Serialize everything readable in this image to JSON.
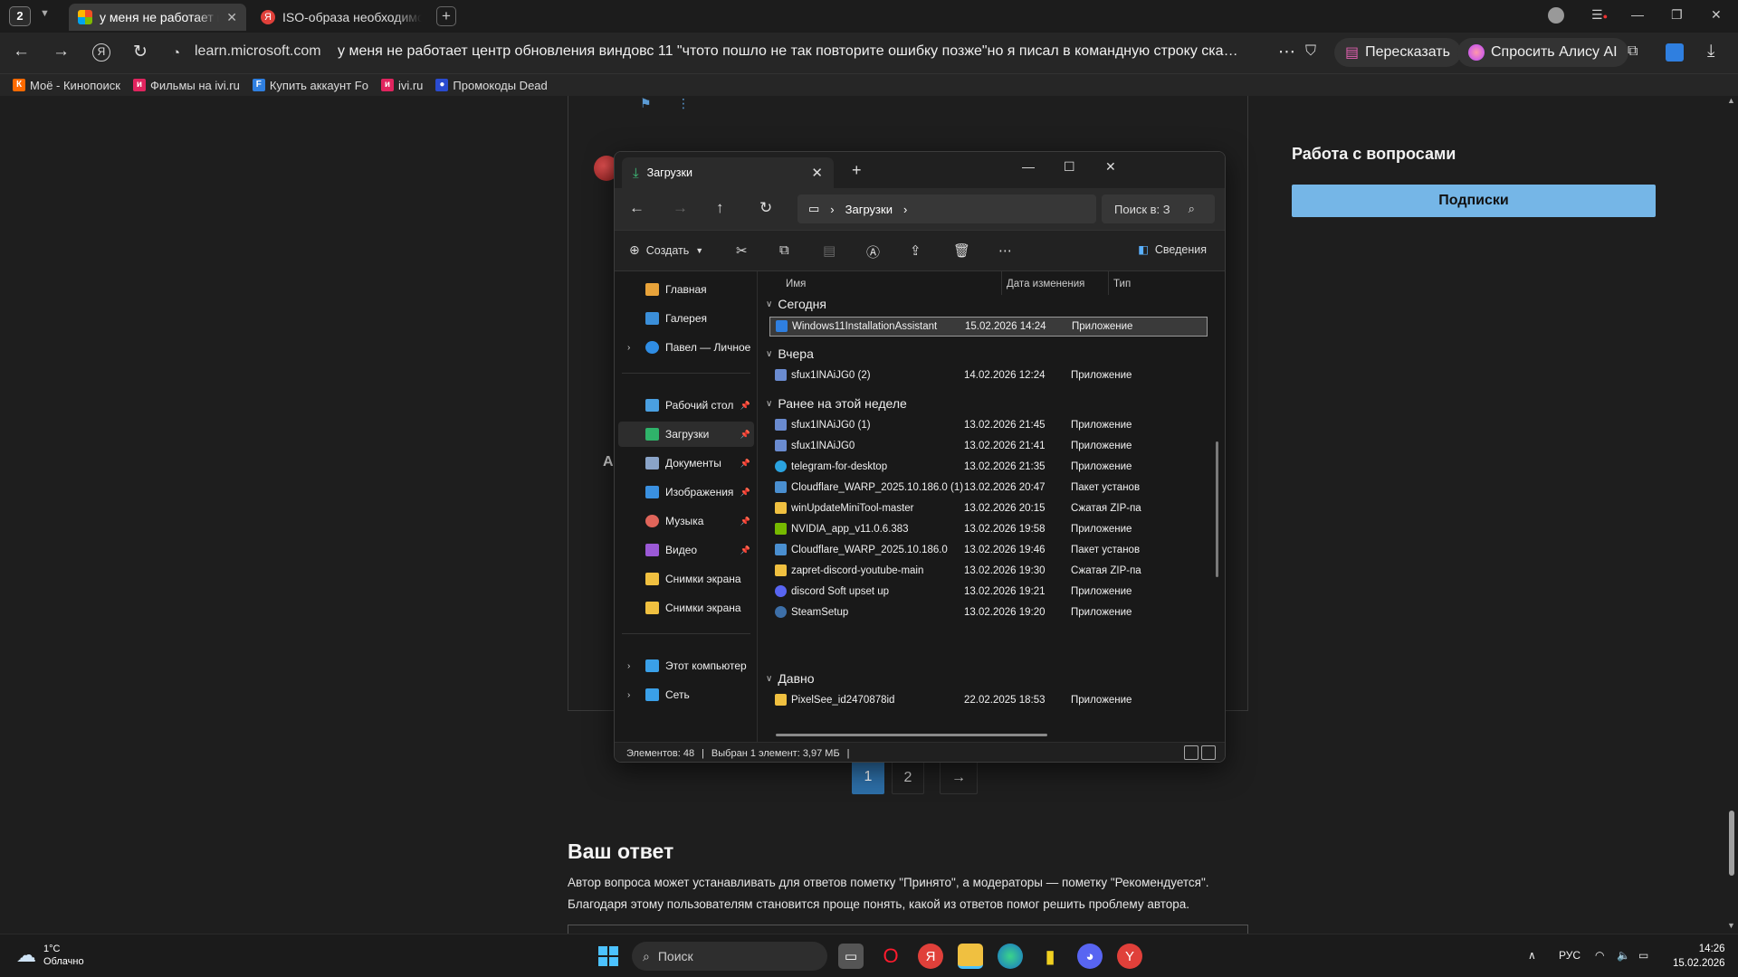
{
  "browser": {
    "tab_count": "2",
    "tabs": [
      {
        "label": "у меня не работает це",
        "active": true
      },
      {
        "label": "ISO-образа необходимо",
        "active": false
      }
    ],
    "url_domain": "learn.microsoft.com",
    "url_title": "у меня не работает центр обновления виндовс 11 \"чтото пошло не так повторите ошибку позже\"но я писал в командную строку сканнад,дис...",
    "retell_label": "Пересказать",
    "alice_label": "Спросить Алису AI",
    "bookmarks": [
      "Моё - Кинопоиск",
      "Фильмы на ivi.ru",
      "Купить аккаунт Fo",
      "ivi.ru",
      "Промокоды Dead"
    ]
  },
  "page": {
    "side_title": "Работа с вопросами",
    "subscribe_label": "Подписки",
    "avatar_letter": "A",
    "pager": {
      "current": "1",
      "second": "2"
    },
    "answer_title": "Ваш ответ",
    "answer_text_1": "Автор вопроса может устанавливать для ответов пометку \"Принято\", а модераторы — пометку \"Рекомендуется\".",
    "answer_text_2": "Благодаря этому пользователям становится проще понять, какой из ответов помог решить проблему автора."
  },
  "explorer": {
    "tab_title": "Загрузки",
    "path": "Загрузки",
    "search_placeholder": "Поиск в: З",
    "create_label": "Создать",
    "details_label": "Сведения",
    "nav": [
      {
        "label": "Главная",
        "color": "#e8a33a"
      },
      {
        "label": "Галерея",
        "color": "#3b8fd9"
      },
      {
        "label": "Павел — Личное",
        "color": "#2f8de4"
      },
      {
        "label": "Рабочий стол",
        "color": "#4a9fe0"
      },
      {
        "label": "Загрузки",
        "color": "#2fb36a"
      },
      {
        "label": "Документы",
        "color": "#8aa4c8"
      },
      {
        "label": "Изображения",
        "color": "#3a90e0"
      },
      {
        "label": "Музыка",
        "color": "#e0655a"
      },
      {
        "label": "Видео",
        "color": "#9b59d6"
      },
      {
        "label": "Снимки экрана",
        "color": "#f0c040"
      },
      {
        "label": "Снимки экрана",
        "color": "#f0c040"
      },
      {
        "label": "Этот компьютер",
        "color": "#3aa0e8"
      },
      {
        "label": "Сеть",
        "color": "#3aa0e8"
      }
    ],
    "columns": {
      "name": "Имя",
      "date": "Дата изменения",
      "type": "Тип"
    },
    "groups": {
      "today": "Сегодня",
      "yesterday": "Вчера",
      "this_week": "Ранее на этой неделе",
      "long_ago": "Давно"
    },
    "files": [
      {
        "name": "Windows11InstallationAssistant",
        "date": "15.02.2026 14:24",
        "type": "Приложение",
        "icon": "#2f7fe0"
      },
      {
        "name": "sfux1INAiJG0 (2)",
        "date": "14.02.2026 12:24",
        "type": "Приложение",
        "icon": "#6a8bd0"
      },
      {
        "name": "sfux1INAiJG0 (1)",
        "date": "13.02.2026 21:45",
        "type": "Приложение",
        "icon": "#6a8bd0"
      },
      {
        "name": "sfux1INAiJG0",
        "date": "13.02.2026 21:41",
        "type": "Приложение",
        "icon": "#6a8bd0"
      },
      {
        "name": "telegram-for-desktop",
        "date": "13.02.2026 21:35",
        "type": "Приложение",
        "icon": "#2aa3e0"
      },
      {
        "name": "Cloudflare_WARP_2025.10.186.0 (1)",
        "date": "13.02.2026 20:47",
        "type": "Пакет установ",
        "icon": "#4a8fd0"
      },
      {
        "name": "winUpdateMiniTool-master",
        "date": "13.02.2026 20:15",
        "type": "Сжатая ZIP-па",
        "icon": "#f0c040"
      },
      {
        "name": "NVIDIA_app_v11.0.6.383",
        "date": "13.02.2026 19:58",
        "type": "Приложение",
        "icon": "#76b900"
      },
      {
        "name": "Cloudflare_WARP_2025.10.186.0",
        "date": "13.02.2026 19:46",
        "type": "Пакет установ",
        "icon": "#4a8fd0"
      },
      {
        "name": "zapret-discord-youtube-main",
        "date": "13.02.2026 19:30",
        "type": "Сжатая ZIP-па",
        "icon": "#f0c040"
      },
      {
        "name": "discord Soft upset up",
        "date": "13.02.2026 19:21",
        "type": "Приложение",
        "icon": "#5865f2"
      },
      {
        "name": "SteamSetup",
        "date": "13.02.2026 19:20",
        "type": "Приложение",
        "icon": "#3d6fa8"
      },
      {
        "name": "PixelSee_id2470878id",
        "date": "22.02.2025 18:53",
        "type": "Приложение",
        "icon": "#f0c040"
      }
    ],
    "status_count": "Элементов: 48",
    "status_selected": "Выбран 1 элемент: 3,97 МБ"
  },
  "taskbar": {
    "temp": "1°C",
    "weather": "Облачно",
    "search_label": "Поиск",
    "lang": "РУС",
    "time": "14:26",
    "date": "15.02.2026"
  }
}
